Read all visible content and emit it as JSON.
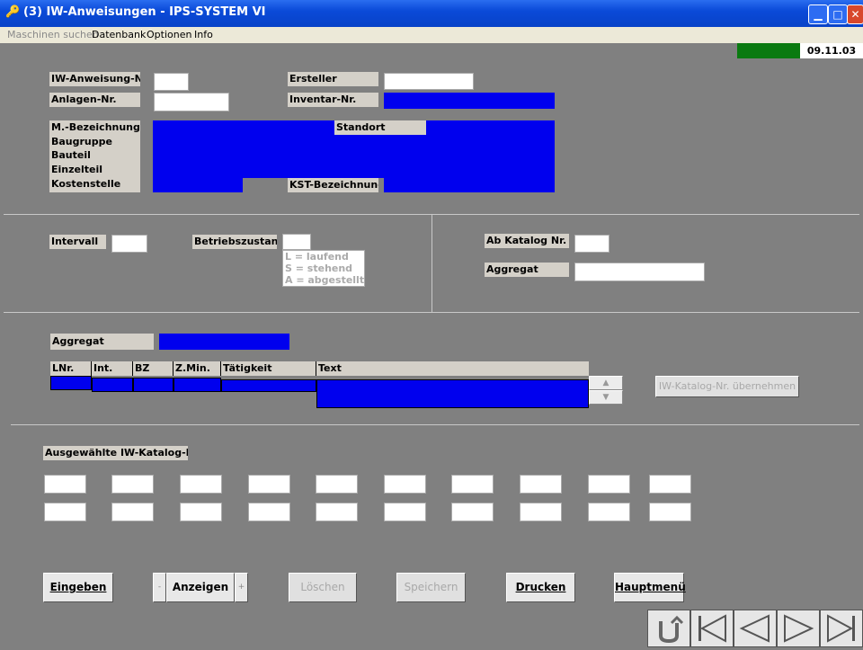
{
  "window": {
    "title": "(3) IW-Anweisungen - IPS-SYSTEM VI"
  },
  "menu": [
    "Maschinen suchen",
    "Datenbank",
    "Optionen",
    "Info"
  ],
  "status": {
    "date": "09.11.03"
  },
  "form": {
    "iw_nr": "IW-Anweisung-Nr.",
    "anlagen_nr": "Anlagen-Nr.",
    "ersteller": "Ersteller",
    "inventar_nr": "Inventar-Nr.",
    "m_bezeichnung": "M.-Bezeichnung",
    "baugruppe": "Baugruppe",
    "bauteil": "Bauteil",
    "einzelteil": "Einzelteil",
    "kostenstelle": "Kostenstelle",
    "standort": "Standort",
    "kst_bezeichnung": "KST-Bezeichnung"
  },
  "section2": {
    "intervall": "Intervall",
    "betriebszustand": "Betriebszustand",
    "hint1": "L = laufend",
    "hint2": "S = stehend",
    "hint3": "A = abgestellt",
    "ab_katalog": "Ab Katalog Nr.",
    "aggregat": "Aggregat"
  },
  "section3": {
    "aggregat": "Aggregat",
    "columns": [
      "LNr.",
      "Int.",
      "BZ",
      "Z.Min.",
      "Tätigkeit",
      "Text"
    ],
    "uebernehmen": "IW-Katalog-Nr. übernehmen"
  },
  "section4": {
    "label": "Ausgewählte IW-Katalog-Nr."
  },
  "buttons": {
    "eingeben": "Eingeben",
    "minus": "-",
    "anzeigen": "Anzeigen",
    "plus": "+",
    "loeschen": "Löschen",
    "speichern": "Speichern",
    "drucken": "Drucken",
    "hauptmenue": "Hauptmenü"
  }
}
